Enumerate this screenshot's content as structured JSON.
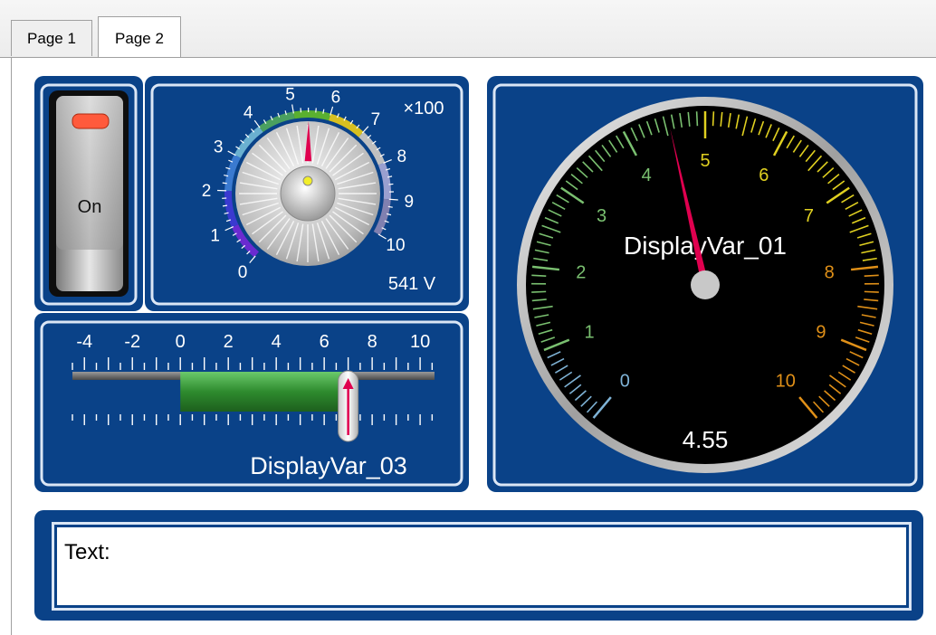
{
  "tabs": [
    {
      "label": "Page 1",
      "active": false
    },
    {
      "label": "Page 2",
      "active": true
    }
  ],
  "switch": {
    "label": "On",
    "state": "on"
  },
  "knob": {
    "scale_labels": [
      "0",
      "1",
      "2",
      "3",
      "4",
      "5",
      "6",
      "7",
      "8",
      "9",
      "10"
    ],
    "multiplier": "×100",
    "readout": "541 V",
    "value": 5.41
  },
  "bar": {
    "scale_labels": [
      "-4",
      "-2",
      "0",
      "2",
      "4",
      "6",
      "8",
      "10"
    ],
    "title": "DisplayVar_03",
    "value": 7
  },
  "gauge": {
    "scale_labels": [
      "0",
      "1",
      "2",
      "3",
      "4",
      "5",
      "6",
      "7",
      "8",
      "9",
      "10"
    ],
    "title": "DisplayVar_01",
    "readout": "4.55",
    "value": 4.55
  },
  "textbox": {
    "text": "Text:"
  },
  "colors": {
    "panel": "#0a4288",
    "panel_border": "#dbe6f5",
    "needle": "#e0004f",
    "bar_fill": "#2e8b2e"
  }
}
